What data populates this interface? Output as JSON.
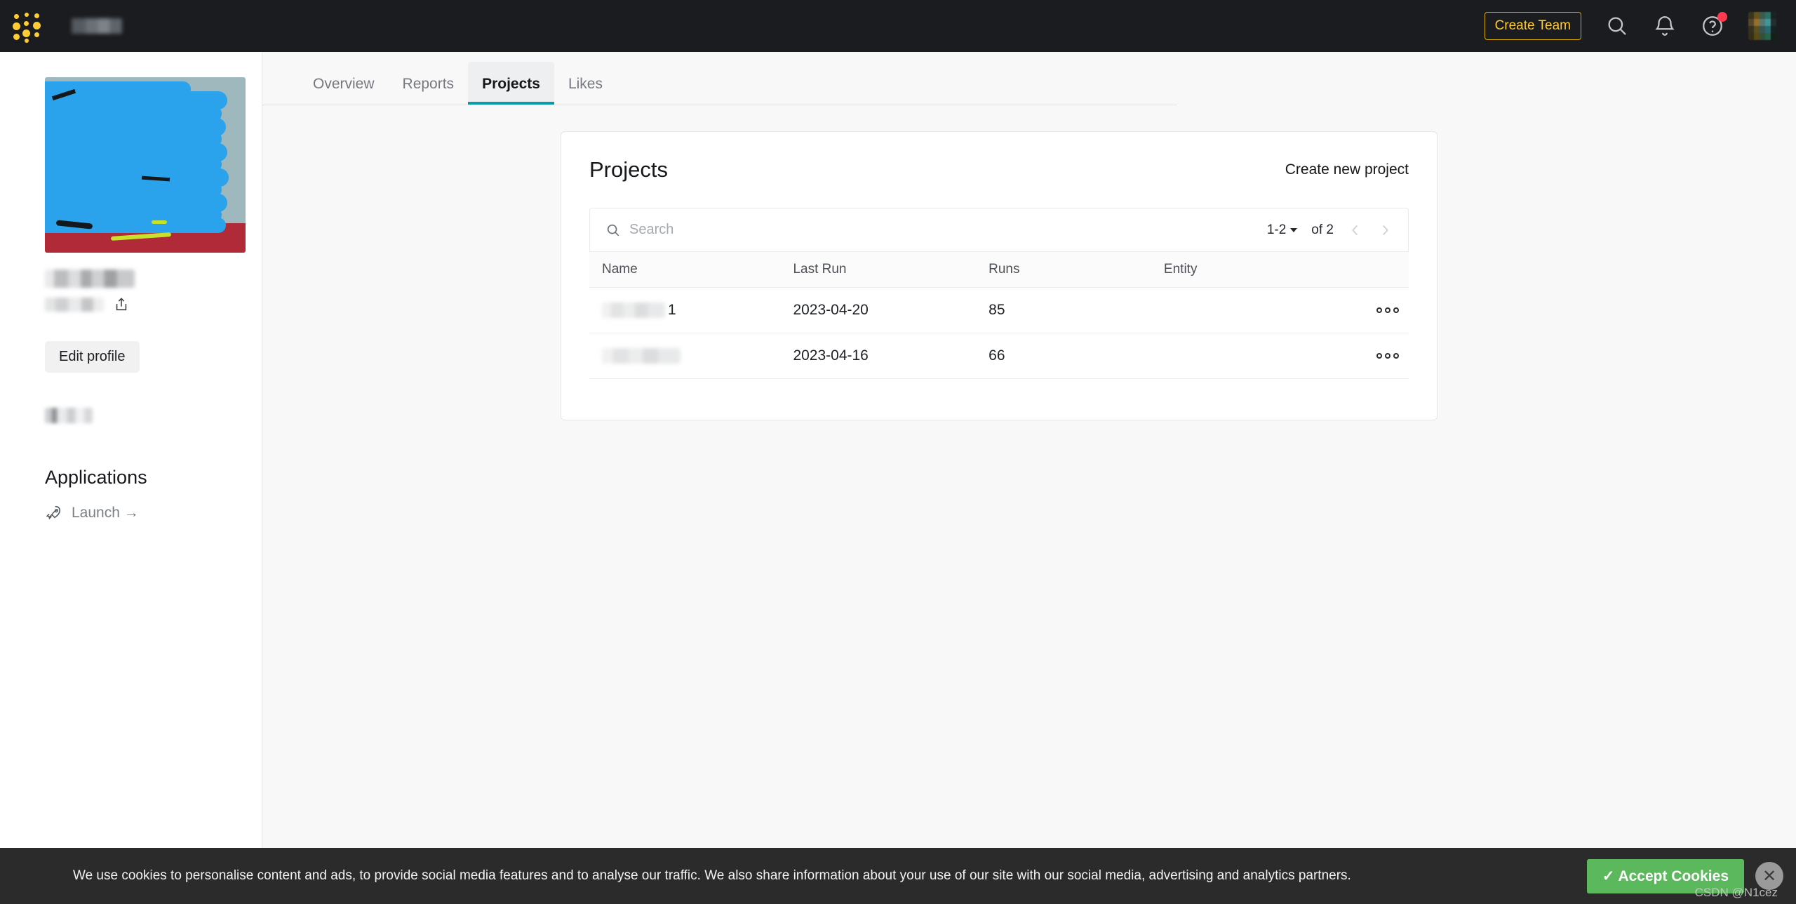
{
  "topnav": {
    "logo_icon": "wandb-dots-logo",
    "username_redacted": "",
    "create_team_label": "Create Team",
    "search_icon": "search-icon",
    "notifications_icon": "bell-icon",
    "help_icon": "question-circle-icon",
    "avatar_icon": "user-avatar",
    "has_notification_badge": true,
    "bg_color": "#1a1c1f",
    "accent_color": "#ffcc33"
  },
  "sidebar": {
    "profile_image_redacted": "",
    "display_name_redacted": "",
    "handle_redacted": "",
    "share_icon": "share-icon",
    "edit_profile_label": "Edit profile",
    "secondary_blur_redacted": "",
    "applications_title": "Applications",
    "launch_icon": "rocket-icon",
    "launch_label": "Launch →"
  },
  "tabs": [
    {
      "label": "Overview",
      "active": false
    },
    {
      "label": "Reports",
      "active": false
    },
    {
      "label": "Projects",
      "active": true
    },
    {
      "label": "Likes",
      "active": false
    }
  ],
  "card": {
    "title": "Projects",
    "create_new_project_label": "Create new project",
    "accent_color": "#0b9ca8"
  },
  "search": {
    "placeholder": "Search",
    "value": "",
    "icon": "search-icon"
  },
  "pagination": {
    "range_label": "1-2",
    "caret_icon": "chevron-down-icon",
    "of_label": "of 2",
    "prev_icon": "chevron-left-icon",
    "next_icon": "chevron-right-icon"
  },
  "table": {
    "columns": [
      "Name",
      "Last Run",
      "Runs",
      "Entity"
    ],
    "rows": [
      {
        "name_redacted": "",
        "name_suffix": "1",
        "last_run": "2023-04-20",
        "runs": "85",
        "entity_redacted": "",
        "menu_icon": "kebab-menu-icon"
      },
      {
        "name_redacted": "",
        "name_suffix": "",
        "last_run": "2023-04-16",
        "runs": "66",
        "entity_redacted": "",
        "menu_icon": "kebab-menu-icon"
      }
    ]
  },
  "cookie_banner": {
    "message": "We use cookies to personalise content and ads, to provide social media features and to analyse our traffic. We also share information about your use of our site with our social media, advertising and analytics partners.",
    "accept_label": "✓ Accept Cookies",
    "close_icon": "close-icon",
    "accept_color": "#5cb85c",
    "bg_color": "#2b2b2b"
  },
  "watermark": {
    "text": "CSDN @N1cez"
  }
}
